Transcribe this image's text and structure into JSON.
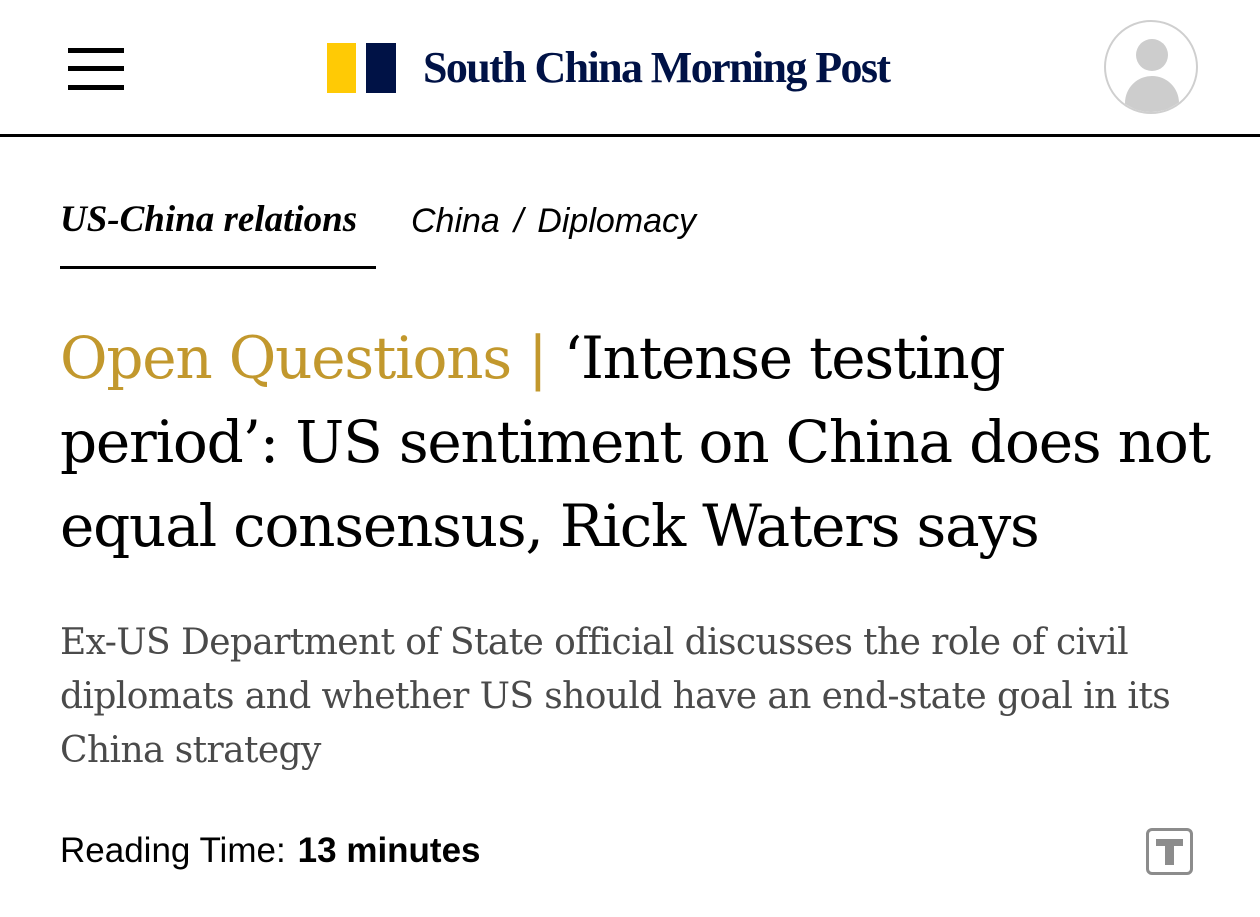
{
  "header": {
    "menu_icon": "hamburger-menu-icon",
    "logo": {
      "text": "South China Morning Post",
      "colors": {
        "yellow": "#FFCA05",
        "navy": "#001246"
      }
    },
    "avatar_icon": "user-avatar-icon"
  },
  "topics": {
    "primary": "US-China relations",
    "breadcrumb": [
      "China",
      "Diplomacy"
    ],
    "separator": "/"
  },
  "article": {
    "kicker": "Open Questions",
    "kicker_separator": "|",
    "title": "‘Intense testing period’: US sentiment on China does not equal consensus, Rick Waters says",
    "summary": "Ex-US Department of State official discusses the role of civil diplomats and whether US should have an end-state goal in its China strategy",
    "reading_time_label": "Reading Time:",
    "reading_time_value": "13 minutes",
    "text_size_icon": "text-size-icon"
  },
  "colors": {
    "kicker": "#C2982D",
    "summary_text": "#4a4a4a",
    "divider": "#000000"
  }
}
